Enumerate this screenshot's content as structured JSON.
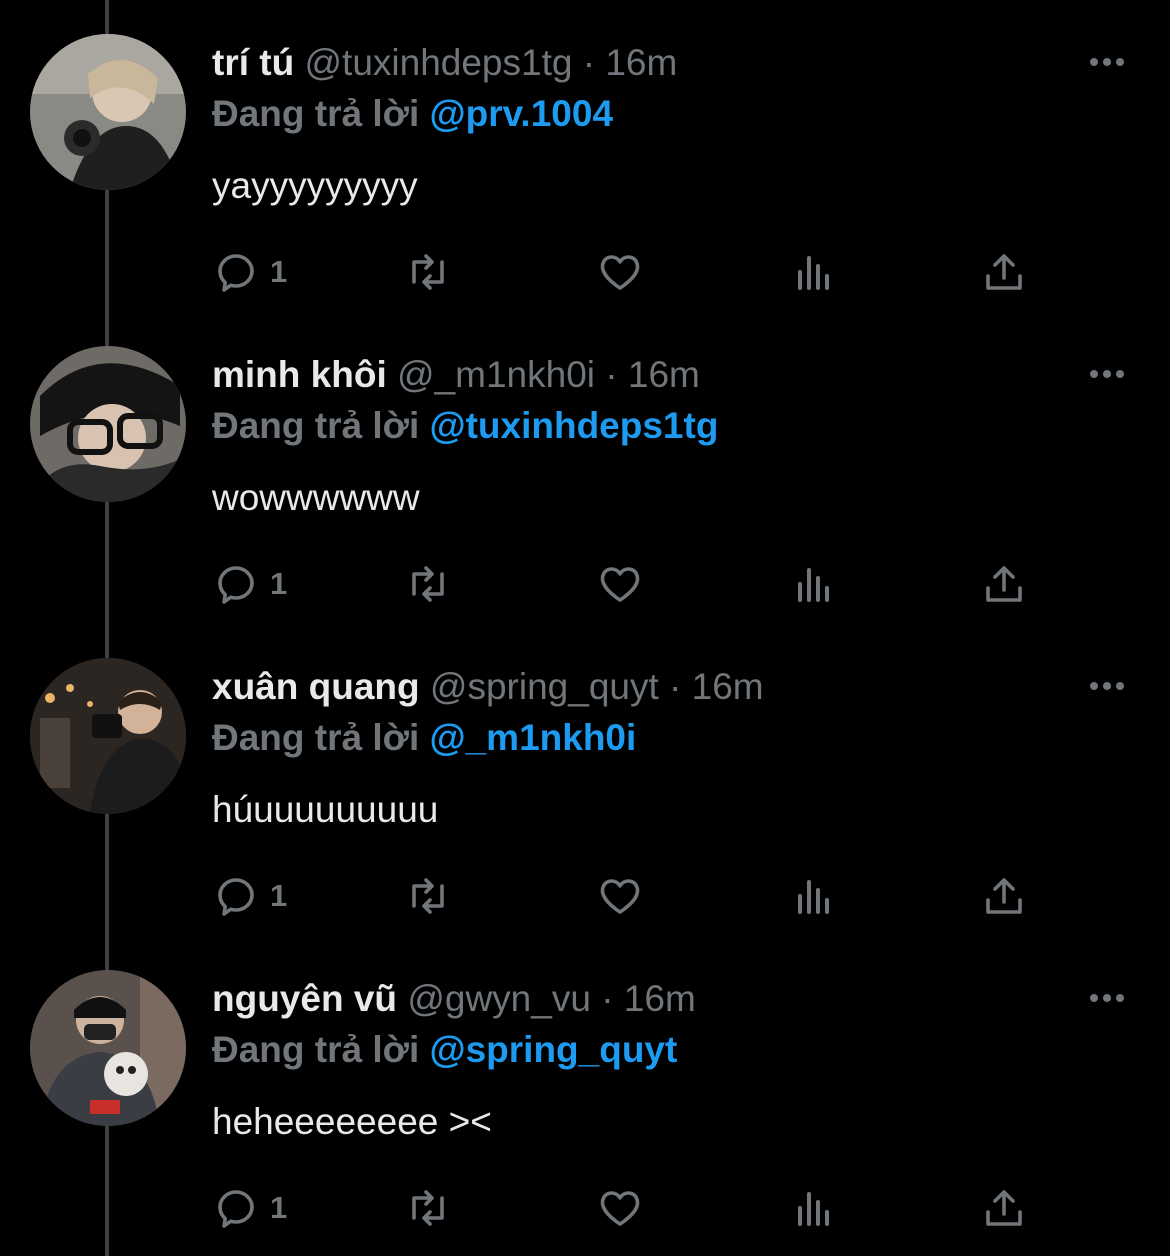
{
  "colors": {
    "background": "#000000",
    "name": "#e7e9ea",
    "muted": "#71767b",
    "link": "#1d9bf0",
    "thread_line": "#3e4144"
  },
  "icons": {
    "more": "more-horizontal-icon",
    "reply": "reply-bubble-icon",
    "retweet": "retweet-icon",
    "like": "heart-icon",
    "views": "views-bar-icon",
    "share": "share-upload-icon"
  },
  "tweets": [
    {
      "name": "trí tú",
      "handle": "@tuxinhdeps1tg",
      "dot": "·",
      "time": "16m",
      "reply_prefix": "Đang trả lời",
      "reply_to": "@prv.1004",
      "text": "yayyyyyyyyy",
      "reply_count": "1"
    },
    {
      "name": "minh khôi",
      "handle": "@_m1nkh0i",
      "dot": "·",
      "time": "16m",
      "reply_prefix": "Đang trả lời",
      "reply_to": "@tuxinhdeps1tg",
      "text": "wowwwwww",
      "reply_count": "1"
    },
    {
      "name": "xuân quang",
      "handle": "@spring_quyt",
      "dot": "·",
      "time": "16m",
      "reply_prefix": "Đang trả lời",
      "reply_to": "@_m1nkh0i",
      "text": "húuuuuuuuuu",
      "reply_count": "1"
    },
    {
      "name": "nguyên vũ",
      "handle": "@gwyn_vu",
      "dot": "·",
      "time": "16m",
      "reply_prefix": "Đang trả lời",
      "reply_to": "@spring_quyt",
      "text": "heheeeeeeee ><",
      "reply_count": "1"
    }
  ]
}
